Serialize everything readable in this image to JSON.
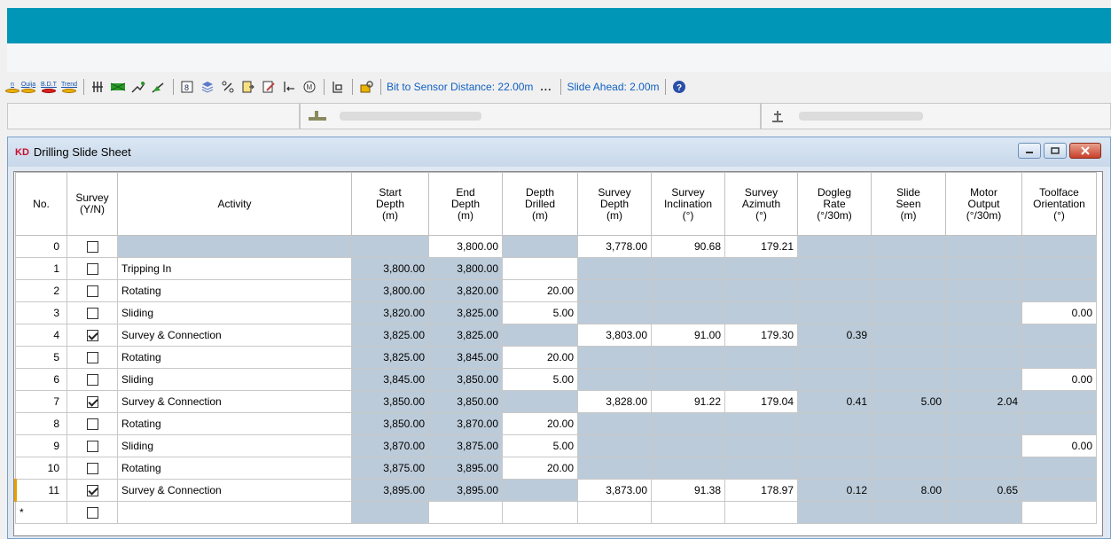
{
  "toolbar": {
    "icons": [
      {
        "name": "partial-left-icon",
        "label": "n"
      },
      {
        "name": "ouija-icon",
        "label": "Ouija"
      },
      {
        "name": "bdt-icon",
        "label": "B.D.T"
      },
      {
        "name": "trend-icon",
        "label": "Trend"
      }
    ],
    "bit_to_sensor": "Bit to Sensor Distance: 22.00m",
    "more": "...",
    "slide_ahead": "Slide Ahead: 2.00m",
    "help_icon": "help-icon"
  },
  "window": {
    "logo": "KD",
    "title": "Drilling Slide Sheet"
  },
  "grid": {
    "headers": [
      "No.",
      "Survey (Y/N)",
      "Activity",
      "Start Depth (m)",
      "End Depth (m)",
      "Depth Drilled (m)",
      "Survey Depth (m)",
      "Survey Inclination (°)",
      "Survey Azimuth (°)",
      "Dogleg Rate (°/30m)",
      "Slide Seen (m)",
      "Motor Output (°/30m)",
      "Toolface Orientation (°)"
    ],
    "header_lines": [
      [
        "No."
      ],
      [
        "Survey",
        "(Y/N)"
      ],
      [
        "Activity"
      ],
      [
        "Start",
        "Depth",
        "(m)"
      ],
      [
        "End",
        "Depth",
        "(m)"
      ],
      [
        "Depth",
        "Drilled",
        "(m)"
      ],
      [
        "Survey",
        "Depth",
        "(m)"
      ],
      [
        "Survey",
        "Inclination",
        "(°)"
      ],
      [
        "Survey",
        "Azimuth",
        "(°)"
      ],
      [
        "Dogleg",
        "Rate",
        "(°/30m)"
      ],
      [
        "Slide",
        "Seen",
        "(m)"
      ],
      [
        "Motor",
        "Output",
        "(°/30m)"
      ],
      [
        "Toolface",
        "Orientation",
        "(°)"
      ]
    ],
    "rows": [
      {
        "no": "0",
        "survey": false,
        "activity": "",
        "start": "",
        "end": "3,800.00",
        "drilled": "",
        "sdepth": "3,778.00",
        "incl": "90.68",
        "azim": "179.21",
        "dogleg": "",
        "seen": "",
        "motor": "",
        "toolface": ""
      },
      {
        "no": "1",
        "survey": false,
        "activity": "Tripping In",
        "start": "3,800.00",
        "end": "3,800.00",
        "drilled": "",
        "sdepth": "",
        "incl": "",
        "azim": "",
        "dogleg": "",
        "seen": "",
        "motor": "",
        "toolface": ""
      },
      {
        "no": "2",
        "survey": false,
        "activity": "Rotating",
        "start": "3,800.00",
        "end": "3,820.00",
        "drilled": "20.00",
        "sdepth": "",
        "incl": "",
        "azim": "",
        "dogleg": "",
        "seen": "",
        "motor": "",
        "toolface": ""
      },
      {
        "no": "3",
        "survey": false,
        "activity": "Sliding",
        "start": "3,820.00",
        "end": "3,825.00",
        "drilled": "5.00",
        "sdepth": "",
        "incl": "",
        "azim": "",
        "dogleg": "",
        "seen": "",
        "motor": "",
        "toolface": "0.00"
      },
      {
        "no": "4",
        "survey": true,
        "activity": "Survey & Connection",
        "start": "3,825.00",
        "end": "3,825.00",
        "drilled": "",
        "sdepth": "3,803.00",
        "incl": "91.00",
        "azim": "179.30",
        "dogleg": "0.39",
        "seen": "",
        "motor": "",
        "toolface": ""
      },
      {
        "no": "5",
        "survey": false,
        "activity": "Rotating",
        "start": "3,825.00",
        "end": "3,845.00",
        "drilled": "20.00",
        "sdepth": "",
        "incl": "",
        "azim": "",
        "dogleg": "",
        "seen": "",
        "motor": "",
        "toolface": ""
      },
      {
        "no": "6",
        "survey": false,
        "activity": "Sliding",
        "start": "3,845.00",
        "end": "3,850.00",
        "drilled": "5.00",
        "sdepth": "",
        "incl": "",
        "azim": "",
        "dogleg": "",
        "seen": "",
        "motor": "",
        "toolface": "0.00"
      },
      {
        "no": "7",
        "survey": true,
        "activity": "Survey & Connection",
        "start": "3,850.00",
        "end": "3,850.00",
        "drilled": "",
        "sdepth": "3,828.00",
        "incl": "91.22",
        "azim": "179.04",
        "dogleg": "0.41",
        "seen": "5.00",
        "motor": "2.04",
        "toolface": ""
      },
      {
        "no": "8",
        "survey": false,
        "activity": "Rotating",
        "start": "3,850.00",
        "end": "3,870.00",
        "drilled": "20.00",
        "sdepth": "",
        "incl": "",
        "azim": "",
        "dogleg": "",
        "seen": "",
        "motor": "",
        "toolface": ""
      },
      {
        "no": "9",
        "survey": false,
        "activity": "Sliding",
        "start": "3,870.00",
        "end": "3,875.00",
        "drilled": "5.00",
        "sdepth": "",
        "incl": "",
        "azim": "",
        "dogleg": "",
        "seen": "",
        "motor": "",
        "toolface": "0.00"
      },
      {
        "no": "10",
        "survey": false,
        "activity": "Rotating",
        "start": "3,875.00",
        "end": "3,895.00",
        "drilled": "20.00",
        "sdepth": "",
        "incl": "",
        "azim": "",
        "dogleg": "",
        "seen": "",
        "motor": "",
        "toolface": ""
      },
      {
        "no": "11",
        "survey": true,
        "activity": "Survey & Connection",
        "start": "3,895.00",
        "end": "3,895.00",
        "drilled": "",
        "sdepth": "3,873.00",
        "incl": "91.38",
        "azim": "178.97",
        "dogleg": "0.12",
        "seen": "8.00",
        "motor": "0.65",
        "toolface": ""
      },
      {
        "no": "*",
        "survey": false,
        "activity": "",
        "start": "",
        "end": "",
        "drilled": "",
        "sdepth": "",
        "incl": "",
        "azim": "",
        "dogleg": "",
        "seen": "",
        "motor": "",
        "toolface": ""
      }
    ]
  },
  "colors": {
    "title_band": "#0096b8",
    "grey_cell": "#bccbd9",
    "link_text": "#1060c0",
    "current_row_marker": "#e8a000"
  }
}
